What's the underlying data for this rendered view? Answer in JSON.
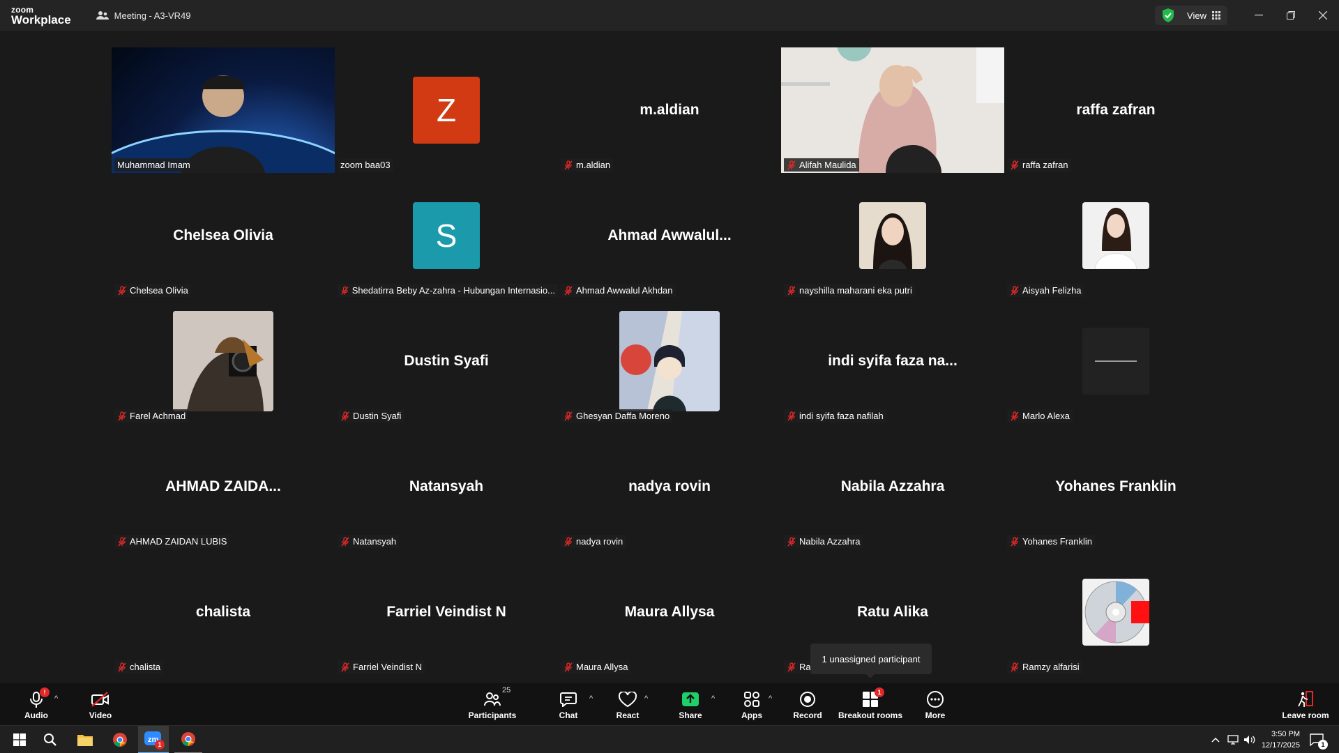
{
  "app": {
    "logo_line1": "zoom",
    "logo_line2": "Workplace",
    "meeting_title": "Meeting - A3-VR49"
  },
  "titlebar": {
    "view_label": "View"
  },
  "tiles": [
    {
      "name": "Muhammad Imam",
      "center": "",
      "type": "video-space",
      "active": true,
      "muted": false
    },
    {
      "name": "zoom baa03",
      "center": "",
      "type": "letter",
      "letter": "Z",
      "color": "#d13a13",
      "muted": false
    },
    {
      "name": "m.aldian",
      "center": "m.aldian",
      "type": "name",
      "muted": true
    },
    {
      "name": "Alifah Maulida",
      "center": "",
      "type": "video-room",
      "muted": true
    },
    {
      "name": "raffa zafran",
      "center": "raffa zafran",
      "type": "name",
      "muted": true
    },
    {
      "name": "Chelsea Olivia",
      "center": "Chelsea Olivia",
      "type": "name",
      "muted": true
    },
    {
      "name": "Shedatirra Beby Az-zahra - Hubungan Internasio...",
      "center": "",
      "type": "letter",
      "letter": "S",
      "color": "#1b9aab",
      "muted": true
    },
    {
      "name": "Ahmad Awwalul Akhdan",
      "center": "Ahmad  Awwalul...",
      "type": "name",
      "muted": true
    },
    {
      "name": "nayshilla maharani eka putri",
      "center": "",
      "type": "photo-girl",
      "muted": true
    },
    {
      "name": "Aisyah Felizha",
      "center": "",
      "type": "photo-white",
      "muted": true
    },
    {
      "name": "Farel Achmad",
      "center": "",
      "type": "photo-camera",
      "muted": true
    },
    {
      "name": "Dustin Syafi",
      "center": "Dustin Syafi",
      "type": "name",
      "muted": true
    },
    {
      "name": "Ghesyan Daffa Moreno",
      "center": "",
      "type": "photo-anime",
      "muted": true
    },
    {
      "name": "indi syifa faza nafilah",
      "center": "indi syifa faza na...",
      "type": "name",
      "muted": true
    },
    {
      "name": "Marlo Alexa",
      "center": "",
      "type": "photo-dark",
      "muted": true
    },
    {
      "name": "AHMAD ZAIDAN LUBIS",
      "center": "AHMAD  ZAIDA...",
      "type": "name",
      "muted": true
    },
    {
      "name": "Natansyah",
      "center": "Natansyah",
      "type": "name",
      "muted": true
    },
    {
      "name": "nadya rovin",
      "center": "nadya rovin",
      "type": "name",
      "muted": true
    },
    {
      "name": "Nabila Azzahra",
      "center": "Nabila Azzahra",
      "type": "name",
      "muted": true
    },
    {
      "name": "Yohanes Franklin",
      "center": "Yohanes Franklin",
      "type": "name",
      "muted": true
    },
    {
      "name": "chalista",
      "center": "chalista",
      "type": "name",
      "muted": true
    },
    {
      "name": "Farriel Veindist N",
      "center": "Farriel Veindist N",
      "type": "name",
      "muted": true
    },
    {
      "name": "Maura Allysa",
      "center": "Maura Allysa",
      "type": "name",
      "muted": true
    },
    {
      "name": "Rat",
      "center": "Ratu Alika",
      "type": "name",
      "muted": true
    },
    {
      "name": "Ramzy alfarisi",
      "center": "",
      "type": "photo-cd",
      "muted": true
    }
  ],
  "tooltip": "1 unassigned participant",
  "toolbar": {
    "audio": "Audio",
    "video": "Video",
    "participants": "Participants",
    "participants_count": "25",
    "chat": "Chat",
    "react": "React",
    "share": "Share",
    "apps": "Apps",
    "record": "Record",
    "breakout": "Breakout rooms",
    "breakout_badge": "1",
    "more": "More",
    "leave": "Leave room",
    "audio_badge": "!"
  },
  "taskbar": {
    "time": "3:50 PM",
    "date": "12/17/2025",
    "zoom_badge": "1",
    "notif_badge": "1"
  },
  "colors": {
    "accent": "#21c7a8",
    "share_green": "#1fcf6a",
    "alert_red": "#e02828"
  }
}
